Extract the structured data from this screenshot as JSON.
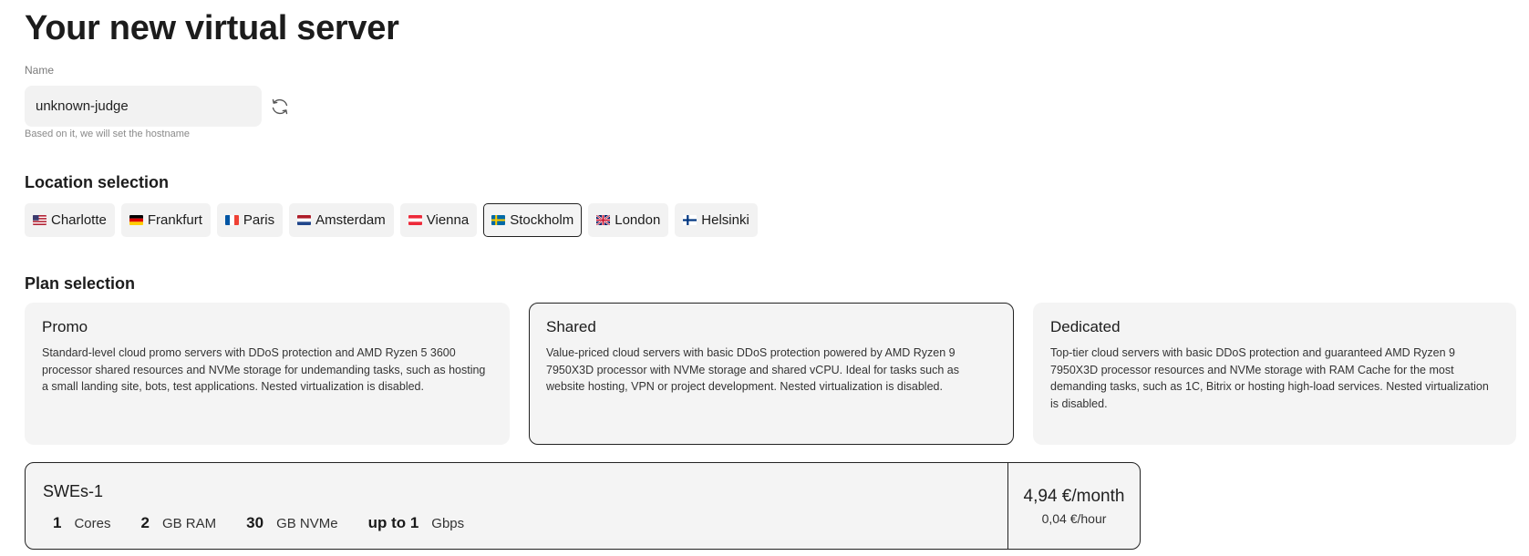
{
  "page": {
    "title": "Your new virtual server"
  },
  "name_field": {
    "label": "Name",
    "value": "unknown-judge",
    "hint": "Based on it, we will set the hostname",
    "refresh_icon": "refresh-icon"
  },
  "locations": {
    "title": "Location selection",
    "selected": "Stockholm",
    "items": [
      {
        "label": "Charlotte",
        "flag": "us"
      },
      {
        "label": "Frankfurt",
        "flag": "de"
      },
      {
        "label": "Paris",
        "flag": "fr"
      },
      {
        "label": "Amsterdam",
        "flag": "nl"
      },
      {
        "label": "Vienna",
        "flag": "at"
      },
      {
        "label": "Stockholm",
        "flag": "se"
      },
      {
        "label": "London",
        "flag": "gb"
      },
      {
        "label": "Helsinki",
        "flag": "fi"
      }
    ]
  },
  "plans": {
    "title": "Plan selection",
    "selected": "Shared",
    "items": [
      {
        "name": "Promo",
        "description": "Standard-level cloud promo servers with DDoS protection and AMD Ryzen 5 3600 processor shared resources and NVMe storage for undemanding tasks, such as hosting a small landing site, bots, test applications. Nested virtualization is disabled."
      },
      {
        "name": "Shared",
        "description": "Value-priced cloud servers with basic DDoS protection powered by AMD Ryzen 9 7950X3D processor with NVMe storage and shared vCPU. Ideal for tasks such as website hosting, VPN or project development. Nested virtualization is disabled."
      },
      {
        "name": "Dedicated",
        "description": "Top-tier cloud servers with basic DDoS protection and guaranteed AMD Ryzen 9 7950X3D processor resources and NVMe storage with RAM Cache for the most demanding tasks, such as 1C, Bitrix or hosting high-load services. Nested virtualization is disabled."
      }
    ]
  },
  "server": {
    "name": "SWEs-1",
    "specs": [
      {
        "value": "1",
        "unit": "Cores"
      },
      {
        "value": "2",
        "unit": "GB RAM"
      },
      {
        "value": "30",
        "unit": "GB NVMe"
      },
      {
        "value": "up to 1",
        "unit": "Gbps"
      }
    ],
    "price_month": "4,94 €/month",
    "price_hour": "0,04 €/hour"
  }
}
